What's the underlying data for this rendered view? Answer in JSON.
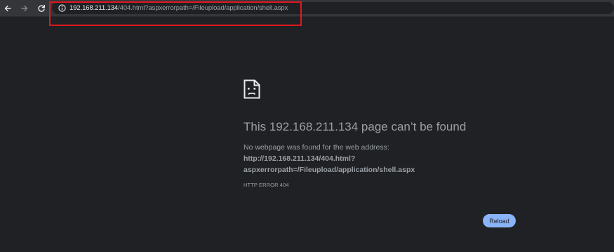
{
  "address_bar": {
    "host": "192.168.211.134",
    "path": "/404.html?aspxerrorpath=/Fileupload/application/shell.aspx"
  },
  "error_page": {
    "title": "This 192.168.211.134 page can’t be found",
    "description": "No webpage was found for the web address:",
    "url_line1": "http://192.168.211.134/404.html?",
    "url_line2": "aspxerrorpath=/Fileupload/application/shell.aspx",
    "error_code": "HTTP ERROR 404",
    "reload_label": "Reload"
  },
  "colors": {
    "page_background": "#202124",
    "toolbar_background": "#35363a",
    "highlight_box": "#e0181f",
    "reload_button": "#8ab4f8",
    "text": "#9aa0a6"
  },
  "icons": [
    "back-arrow-icon",
    "forward-arrow-icon",
    "reload-icon",
    "info-icon",
    "sad-page-icon"
  ]
}
